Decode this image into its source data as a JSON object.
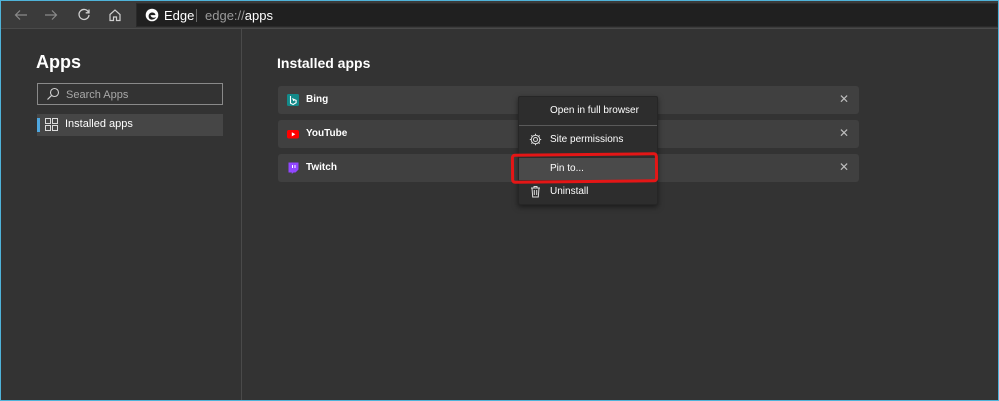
{
  "browser": {
    "brand_label": "Edge",
    "url_scheme": "edge://",
    "url_path": "apps",
    "accent_frame": "#4fb3d9"
  },
  "sidebar": {
    "title": "Apps",
    "search": {
      "placeholder": "Search Apps",
      "value": ""
    },
    "items": [
      {
        "label": "Installed apps",
        "selected": true,
        "icon": "apps-grid-icon"
      }
    ]
  },
  "main": {
    "title": "Installed apps",
    "apps": [
      {
        "name": "Bing",
        "icon": "bing-icon",
        "color": "#138a8a"
      },
      {
        "name": "YouTube",
        "icon": "youtube-icon",
        "color": "#ff0000"
      },
      {
        "name": "Twitch",
        "icon": "twitch-icon",
        "color": "#9146ff"
      }
    ]
  },
  "context_menu": {
    "items": [
      {
        "label": "Open in full browser",
        "icon": ""
      },
      {
        "label": "Site permissions",
        "icon": "gear-icon"
      },
      {
        "label": "Pin to...",
        "icon": "",
        "highlighted": true
      },
      {
        "label": "Uninstall",
        "icon": "trash-icon"
      }
    ],
    "annotation_color": "#e41616"
  }
}
